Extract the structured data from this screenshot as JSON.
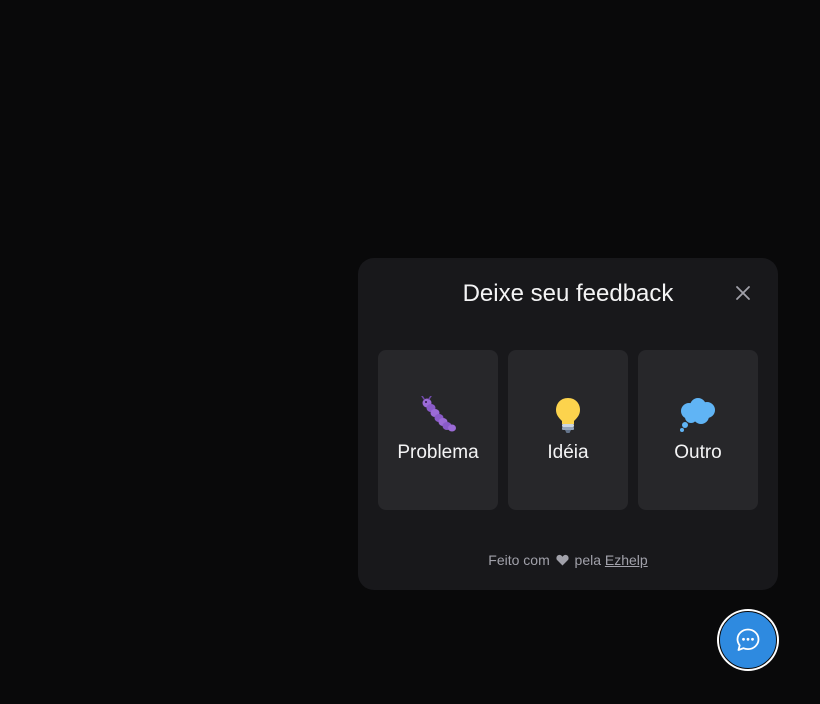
{
  "widget": {
    "title": "Deixe seu feedback",
    "close_icon": "close-icon",
    "types": [
      {
        "label": "Problema",
        "icon": "caterpillar-bug-icon"
      },
      {
        "label": "Idéia",
        "icon": "lightbulb-icon"
      },
      {
        "label": "Outro",
        "icon": "thought-balloon-icon"
      }
    ],
    "footer": {
      "prefix": "Feito com",
      "heart_icon": "heart-icon",
      "middle": "pela",
      "link": "Ezhelp"
    }
  },
  "launcher": {
    "icon": "chat-bubble-icon"
  },
  "colors": {
    "background": "#09090a",
    "panel": "#18181b",
    "card": "#27272a",
    "accent": "#2e8ae0",
    "text": "#f4f4f5",
    "muted": "#a1a1aa"
  }
}
